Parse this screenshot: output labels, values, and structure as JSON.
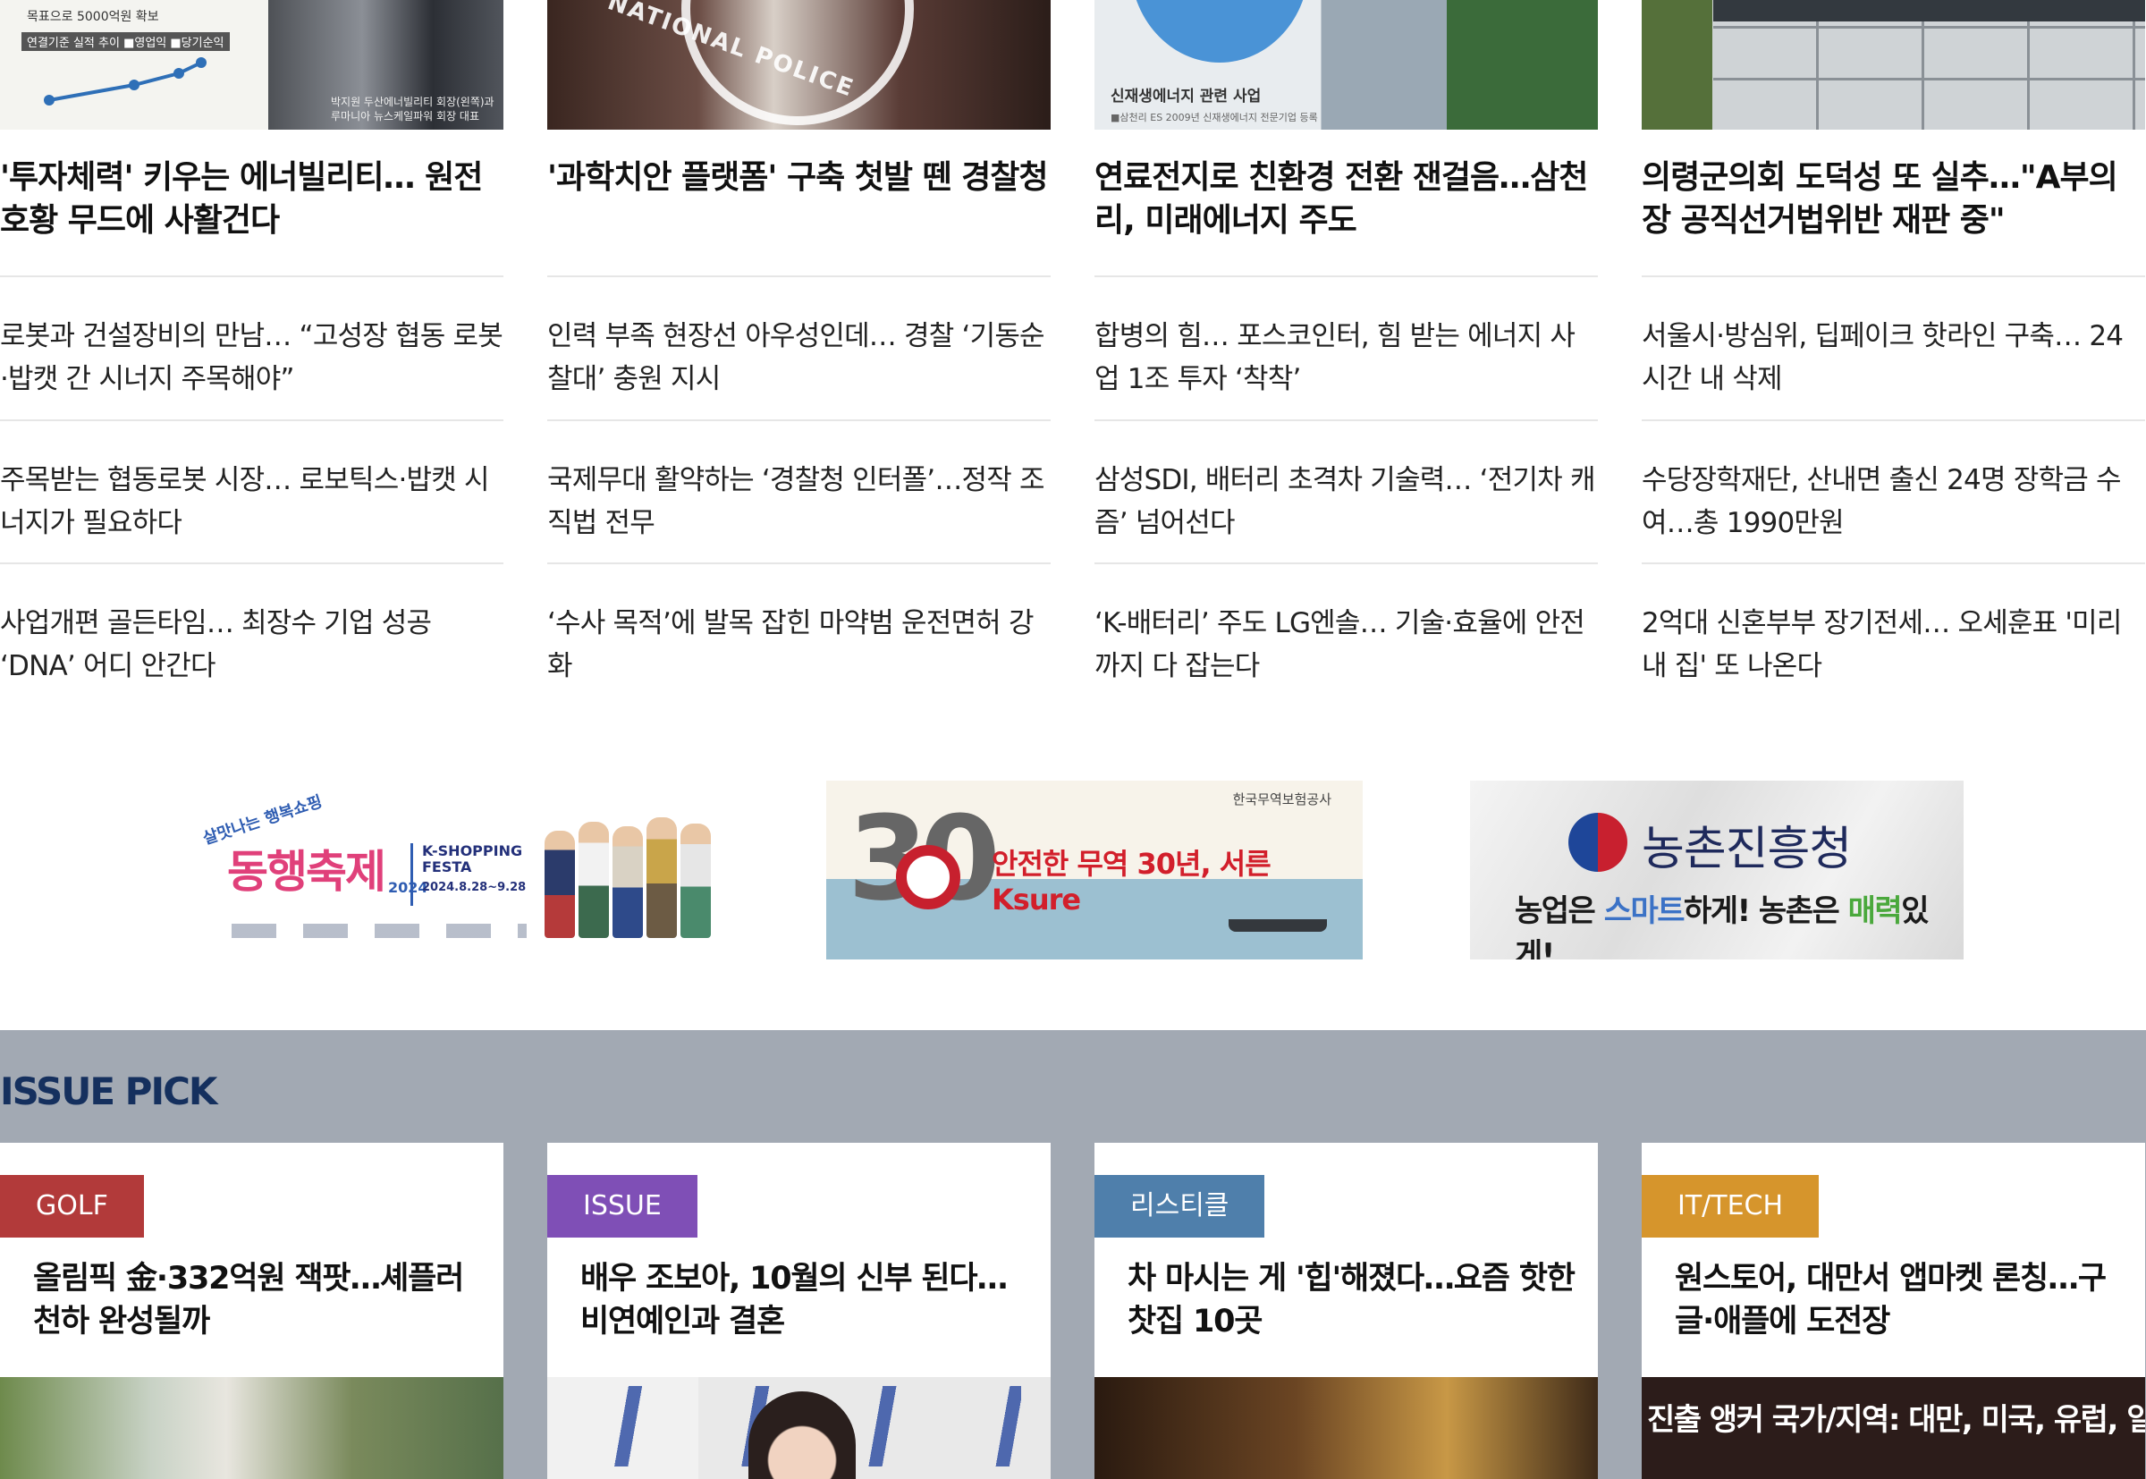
{
  "columns": [
    {
      "thumb_text": {
        "label": "목표으로 5000억원 확보",
        "legend": "연결기준 실적 추이  ■영업익 ■당기순익",
        "caption": "박지원 두산에너빌리티 회장(왼쪽)과\n루마니아 뉴스케일파워 회장 대표"
      },
      "headline": "'투자체력' 키우는 에너빌리티… 원전 호황 무드에 사활건다",
      "subs": [
        "로봇과 건설장비의 만남… “고성장 협동 로봇·밥캣 간 시너지 주목해야”",
        "주목받는 협동로봇 시장… 로보틱스·밥캣 시너지가 필요하다",
        "사업개편 골든타임… 최장수 기업 성공 ‘DNA’ 어디 안간다"
      ]
    },
    {
      "thumb_text": {
        "seal": "NATIONAL POLICE"
      },
      "headline": "'과학치안 플랫폼' 구축 첫발 뗀 경찰청",
      "subs": [
        "인력 부족 현장선 아우성인데… 경찰 ‘기동순찰대’ 충원 지시",
        "국제무대 활약하는 ‘경찰청 인터폴’…정작 조직법 전무",
        "‘수사 목적’에 발목 잡힌 마약범 운전면허 강화"
      ]
    },
    {
      "thumb_text": {
        "caption": "신재생에너지 관련 사업",
        "caption2": "■삼천리 ES 2009년 신재생에너지 전문기업 등록"
      },
      "headline": "연료전지로 친환경 전환 잰걸음…삼천리, 미래에너지 주도",
      "subs": [
        "합병의 힘… 포스코인터, 힘 받는 에너지 사업 1조 투자 ‘착착’",
        "삼성SDI, 배터리 초격차 기술력… ‘전기차 캐즘’ 넘어선다",
        "‘K-배터리’ 주도 LG엔솔… 기술·효율에 안전까지 다 잡는다"
      ]
    },
    {
      "thumb_text": {},
      "headline": "의령군의회 도덕성 또 실추…\"A부의장 공직선거법위반 재판 중\"",
      "subs": [
        "서울시·방심위, 딥페이크 핫라인 구축… 24시간 내 삭제",
        "수당장학재단, 산내면 출신 24명 장학금 수여…총 1990만원",
        "2억대 신혼부부 장기전세… 오세훈표 '미리 내 집' 또 나온다"
      ]
    }
  ],
  "banners": {
    "shopping": {
      "small": "살맛나는 행복쇼핑",
      "title": "동행축제",
      "year": "2024",
      "festa": "K-SHOPPING\nFESTA",
      "dates": "2024.8.28~9.28"
    },
    "ksure": {
      "org": "한국무역보험공사",
      "number": "30",
      "text": "안전한 무역 30년, 서른 Ksure"
    },
    "rda": {
      "name": "농촌진흥청",
      "slogan_pre": "농업은 ",
      "slogan_smart": "스마트",
      "slogan_mid": "하게! 농촌은 ",
      "slogan_charm": "매력",
      "slogan_post": "있게!"
    }
  },
  "issue_pick": {
    "title": "ISSUE PICK",
    "cards": [
      {
        "tag": "GOLF",
        "tag_color": "#b23a3a",
        "title": "올림픽 金·332억원 잭팟…셰플러 천하 완성될까"
      },
      {
        "tag": "ISSUE",
        "tag_color": "#7f4fb6",
        "title": "배우 조보아, 10월의 신부 된다…비연예인과 결혼"
      },
      {
        "tag": "리스티클",
        "tag_color": "#4f7fab",
        "title": "차 마시는 게 '힙'해졌다…요즘 핫한 찻집 10곳"
      },
      {
        "tag": "IT/TECH",
        "tag_color": "#d6952c",
        "title": "원스토어, 대만서 앱마켓 론칭…구글·애플에 도전장",
        "image_text": "진출 앵커 국가/지역: 대만, 미국, 유럽, 일본"
      }
    ]
  }
}
